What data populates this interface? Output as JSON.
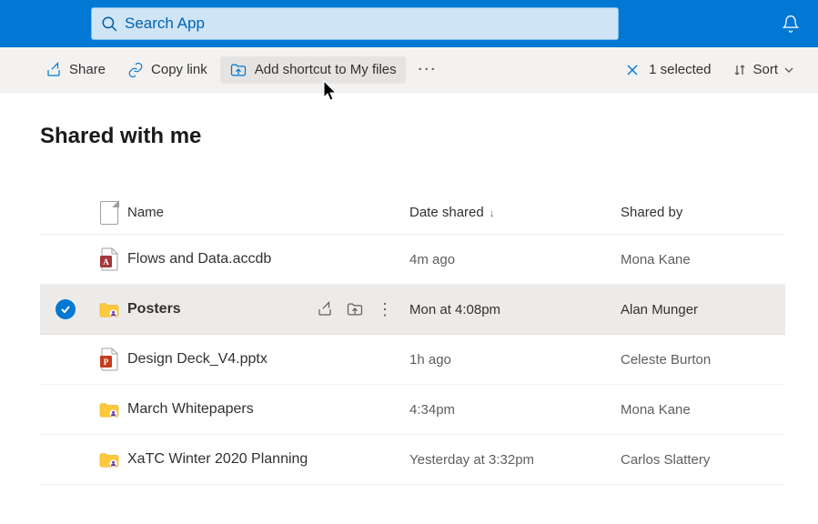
{
  "header": {
    "searchPlaceholder": "Search App"
  },
  "cmdbar": {
    "share": "Share",
    "copyLink": "Copy link",
    "addShortcut": "Add shortcut to My files",
    "selectedCount": "1 selected",
    "sort": "Sort"
  },
  "page": {
    "title": "Shared with me"
  },
  "columns": {
    "name": "Name",
    "dateShared": "Date shared",
    "sharedBy": "Shared by"
  },
  "rows": [
    {
      "name": "Flows and Data.accdb",
      "date": "4m ago",
      "sharedBy": "Mona Kane"
    },
    {
      "name": "Posters",
      "date": "Mon at 4:08pm",
      "sharedBy": "Alan Munger"
    },
    {
      "name": "Design Deck_V4.pptx",
      "date": "1h ago",
      "sharedBy": "Celeste Burton"
    },
    {
      "name": "March Whitepapers",
      "date": "4:34pm",
      "sharedBy": "Mona Kane"
    },
    {
      "name": "XaTC Winter 2020 Planning",
      "date": "Yesterday at 3:32pm",
      "sharedBy": "Carlos Slattery"
    }
  ]
}
